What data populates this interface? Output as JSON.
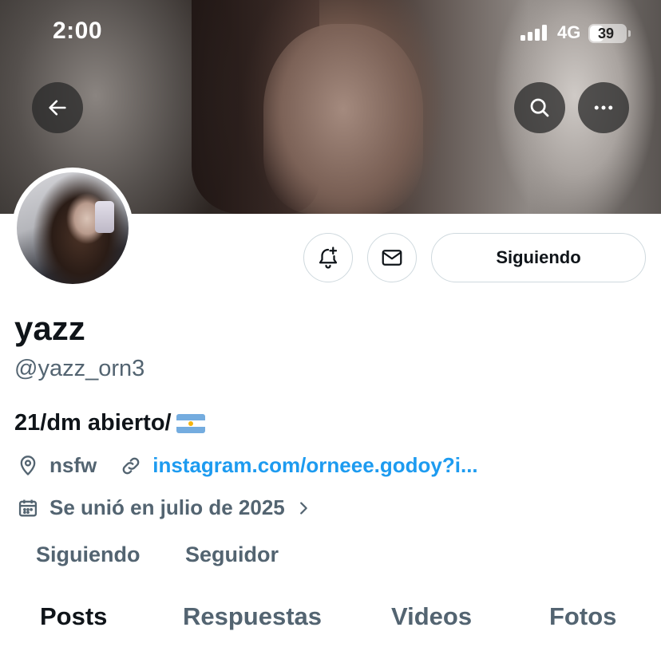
{
  "status_bar": {
    "time": "2:00",
    "network": "4G",
    "battery_percent": "39",
    "battery_level": 0.39
  },
  "header": {
    "back_icon": "arrow-left-icon",
    "search_icon": "search-icon",
    "more_icon": "more-horizontal-icon"
  },
  "actions": {
    "notify_icon": "bell-plus-icon",
    "message_icon": "envelope-icon",
    "follow_label": "Siguiendo"
  },
  "profile": {
    "display_name": "yazz",
    "handle": "@yazz_orn3",
    "bio": "21/dm abierto/",
    "bio_emoji": "argentina-flag",
    "location": "nsfw",
    "website": "instagram.com/orneee.godoy?i...",
    "joined": "Se unió en julio de 2025"
  },
  "stats": {
    "following_label": "Siguiendo",
    "followers_label": "Seguidor"
  },
  "tabs": [
    {
      "label": "Posts",
      "active": true
    },
    {
      "label": "Respuestas",
      "active": false
    },
    {
      "label": "Videos",
      "active": false
    },
    {
      "label": "Fotos",
      "active": false
    }
  ],
  "colors": {
    "link": "#1d9bf0",
    "secondary_text": "#536471",
    "primary_text": "#0f1419",
    "border": "#cfd9de"
  }
}
